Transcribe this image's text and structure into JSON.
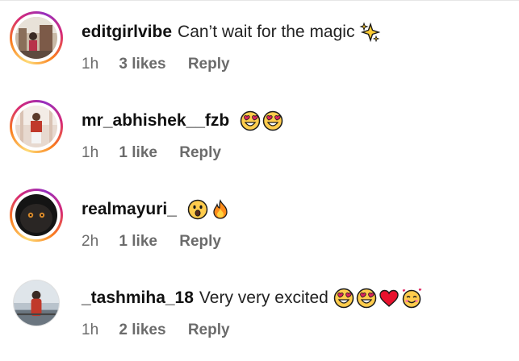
{
  "comments": [
    {
      "username": "editgirlvibe",
      "text": "Can’t wait for the magic",
      "time": "1h",
      "likes": "3 likes",
      "reply": "Reply",
      "emojis": [
        "sparkles-icon"
      ]
    },
    {
      "username": "mr_abhishek__fzb",
      "text": "",
      "time": "1h",
      "likes": "1 like",
      "reply": "Reply",
      "emojis": [
        "heart-eyes-icon",
        "heart-eyes-icon"
      ]
    },
    {
      "username": "realmayuri_",
      "text": "",
      "time": "2h",
      "likes": "1 like",
      "reply": "Reply",
      "emojis": [
        "astonished-face-icon",
        "fire-icon"
      ]
    },
    {
      "username": "_tashmiha_18",
      "text": "Very very excited",
      "time": "1h",
      "likes": "2 likes",
      "reply": "Reply",
      "emojis": [
        "heart-eyes-icon",
        "heart-eyes-icon",
        "red-heart-icon",
        "smiling-face-with-hearts-icon"
      ]
    }
  ],
  "colors": {
    "meta_text": "#6b6b6b",
    "ring": [
      "#feda75",
      "#fa7e1e",
      "#d62976",
      "#962fbf"
    ]
  }
}
